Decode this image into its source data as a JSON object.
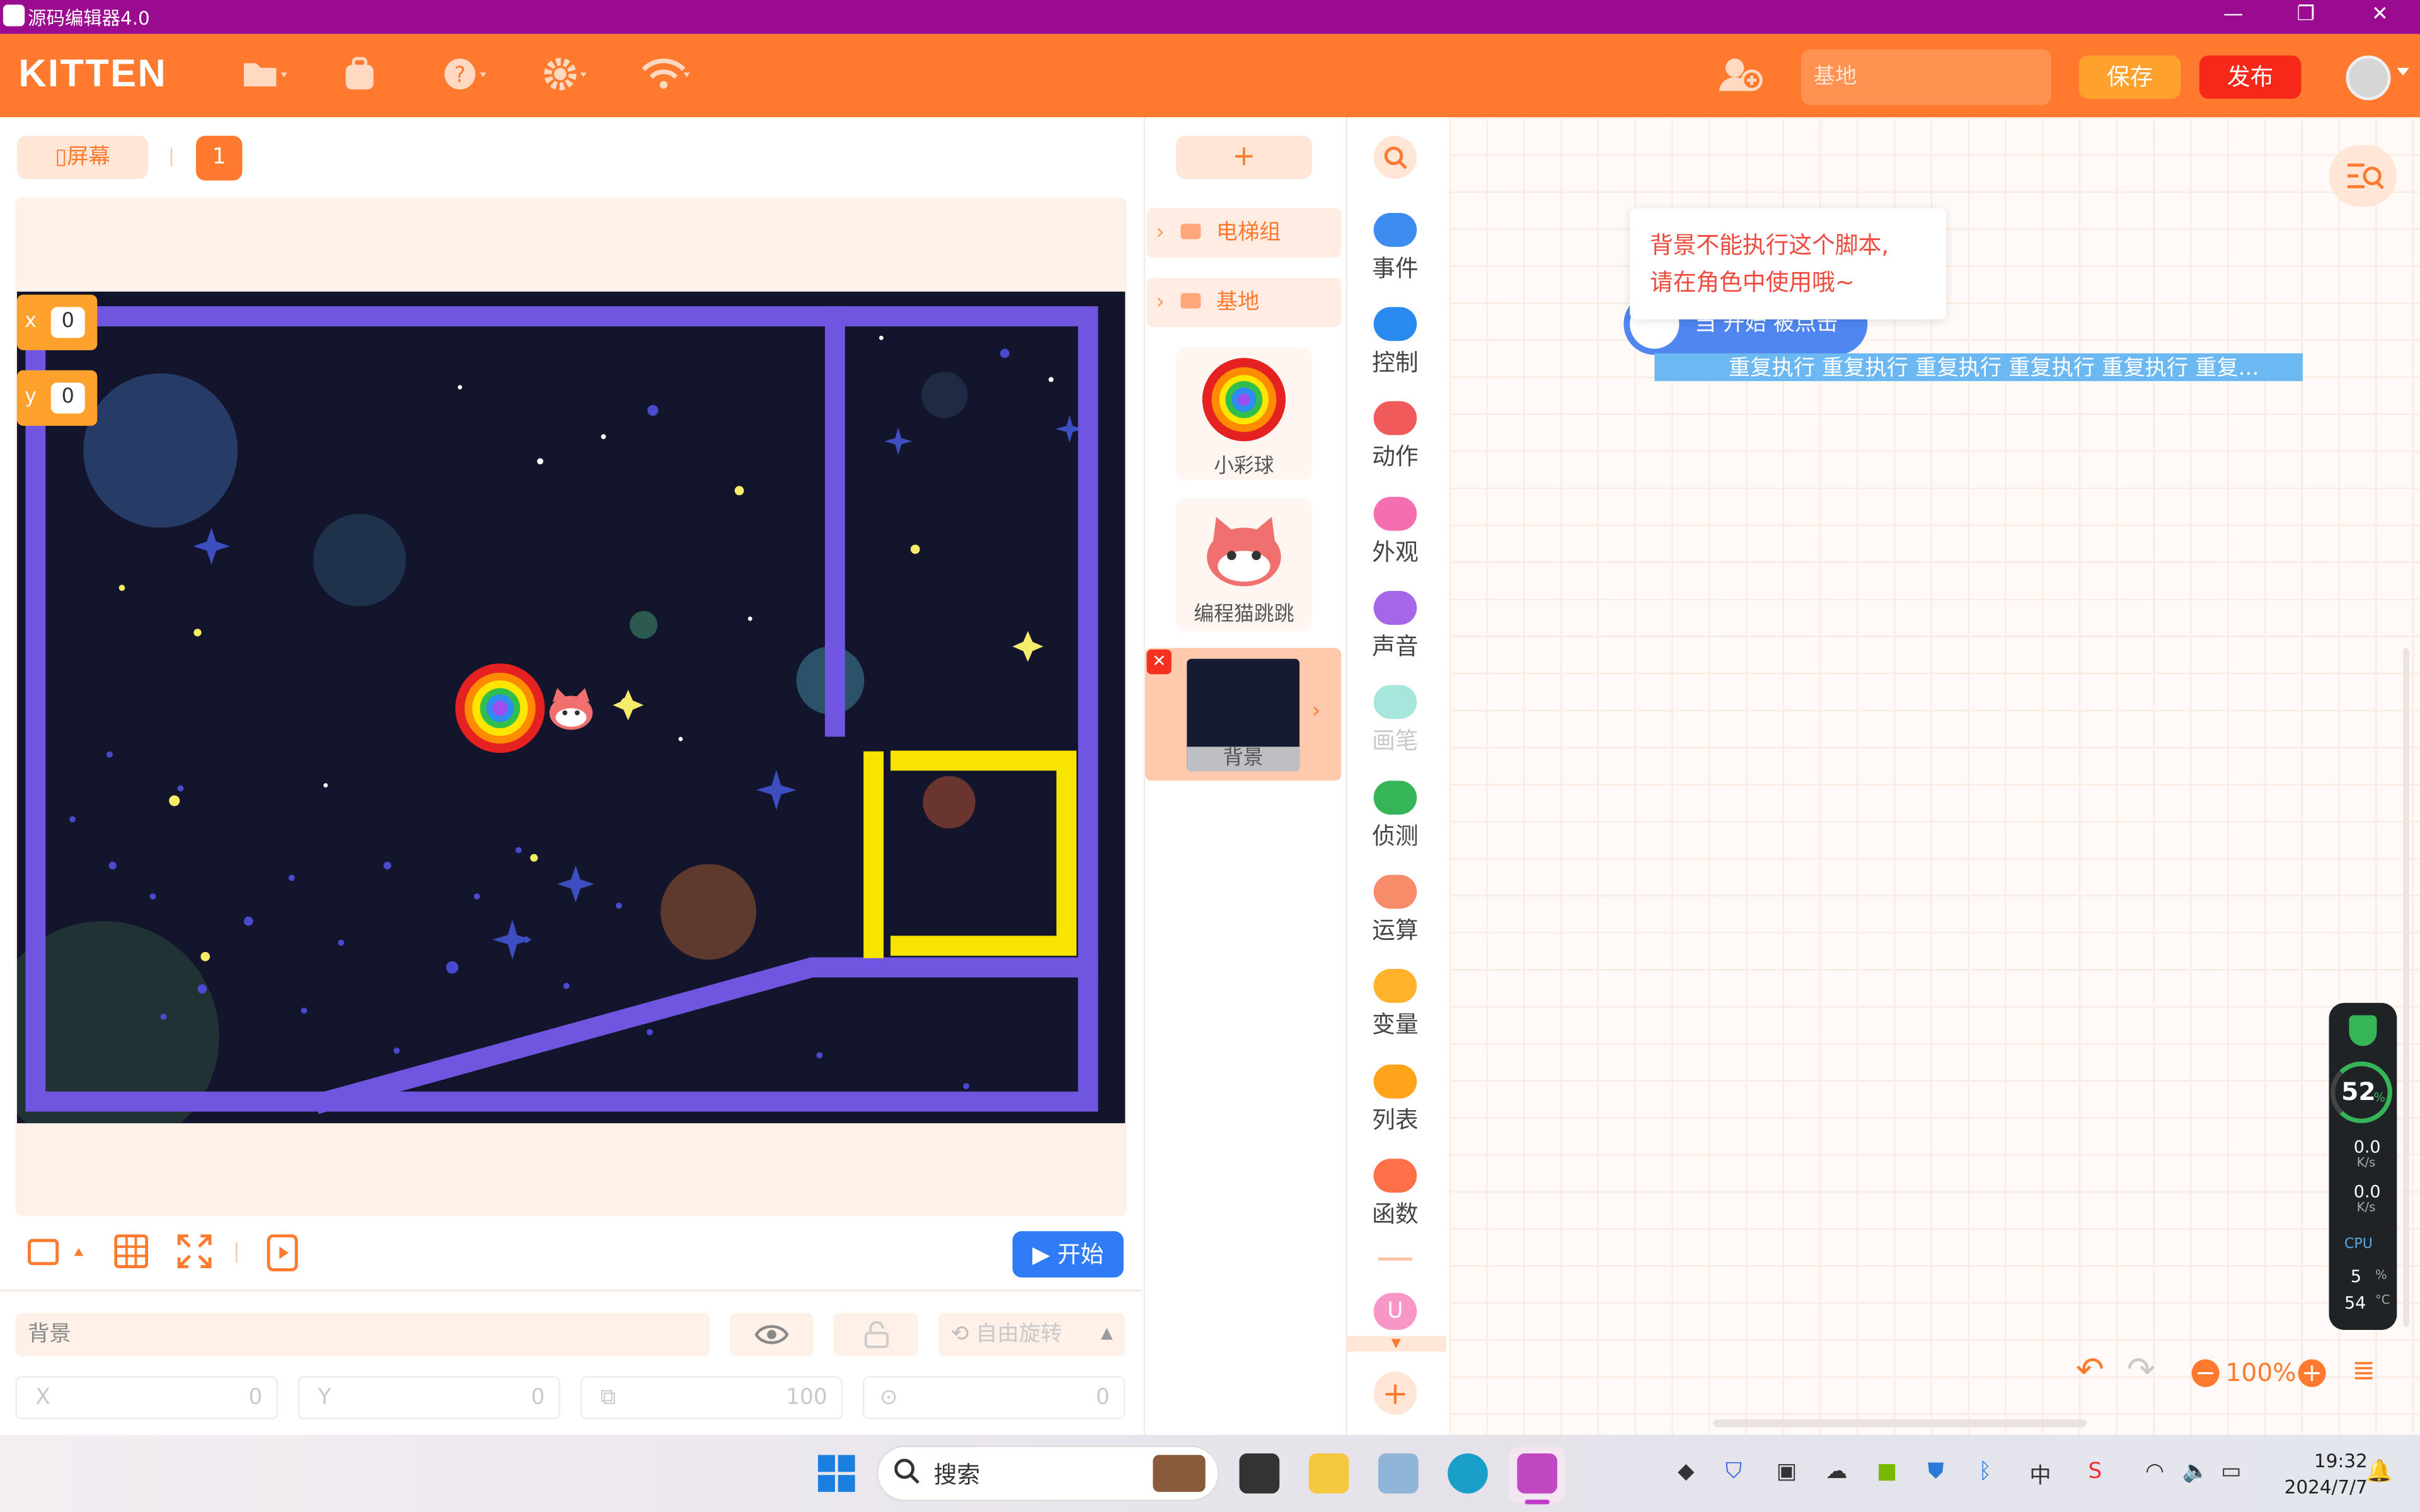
{
  "window": {
    "title": "源码编辑器4.0",
    "min": "—",
    "max": "❐",
    "close": "✕"
  },
  "toolbar": {
    "logo": "KITTEN",
    "search_placeholder": "基地",
    "save_label": "保存",
    "publish_label": "发布",
    "icons": [
      "folder-icon",
      "backpack-icon",
      "help-icon",
      "gear-icon",
      "wifi-icon",
      "add-user-icon"
    ]
  },
  "stage": {
    "screen_label": "屏幕",
    "page_number": "1",
    "x_label": "x",
    "x_value": "0",
    "y_label": "y",
    "y_value": "0",
    "start_label": "开始",
    "selected_name": "背景",
    "rotation_label": "自由旋转",
    "x_field_label": "X",
    "x_field_value": "0",
    "y_field_label": "Y",
    "y_field_value": "0",
    "size_value": "100",
    "direction_value": "0"
  },
  "sprites": {
    "add_label": "+",
    "groups": [
      "电梯组",
      "基地"
    ],
    "items": [
      "小彩球",
      "编程猫跳跳",
      "背景"
    ]
  },
  "categories": [
    {
      "label": "事件",
      "color": "#3d8cf0",
      "icon": "toggle-icon"
    },
    {
      "label": "控制",
      "color": "#2b8af0",
      "icon": "gamepad-icon"
    },
    {
      "label": "动作",
      "color": "#f05a5a",
      "icon": "robot-icon"
    },
    {
      "label": "外观",
      "color": "#f46fb0",
      "icon": "shirt-icon"
    },
    {
      "label": "声音",
      "color": "#a566e8",
      "icon": "music-icon"
    },
    {
      "label": "画笔",
      "color": "#a6e6dc",
      "icon": "pen-icon"
    },
    {
      "label": "侦测",
      "color": "#35b557",
      "icon": "detect-icon"
    },
    {
      "label": "运算",
      "color": "#f78c6b",
      "icon": "calc-icon"
    },
    {
      "label": "变量",
      "color": "#ffb22a",
      "icon": "variable-icon"
    },
    {
      "label": "列表",
      "color": "#ffa41b",
      "icon": "list-icon"
    },
    {
      "label": "函数",
      "color": "#ff6f4a",
      "icon": "function-icon"
    }
  ],
  "workspace": {
    "tooltip_line1": "背景不能执行这个脚本,",
    "tooltip_line2": "请在角色中使用哦~",
    "hat_block": "当 开始 被点击",
    "repeat_block": "重复执行 重复执行 重复执行 重复执行 重复执行 重复...",
    "zoom": "100%"
  },
  "monitor": {
    "percent": "52",
    "percent_unit": "%",
    "up": "0.0",
    "down": "0.0",
    "speed_unit": "K/s",
    "cpu_label": "CPU",
    "cpu_value": "5",
    "cpu_unit": "%",
    "temp_value": "54",
    "temp_unit": "°C"
  },
  "taskbar": {
    "search_label": "搜索",
    "time": "19:32",
    "date": "2024/7/7",
    "ime": "中"
  }
}
